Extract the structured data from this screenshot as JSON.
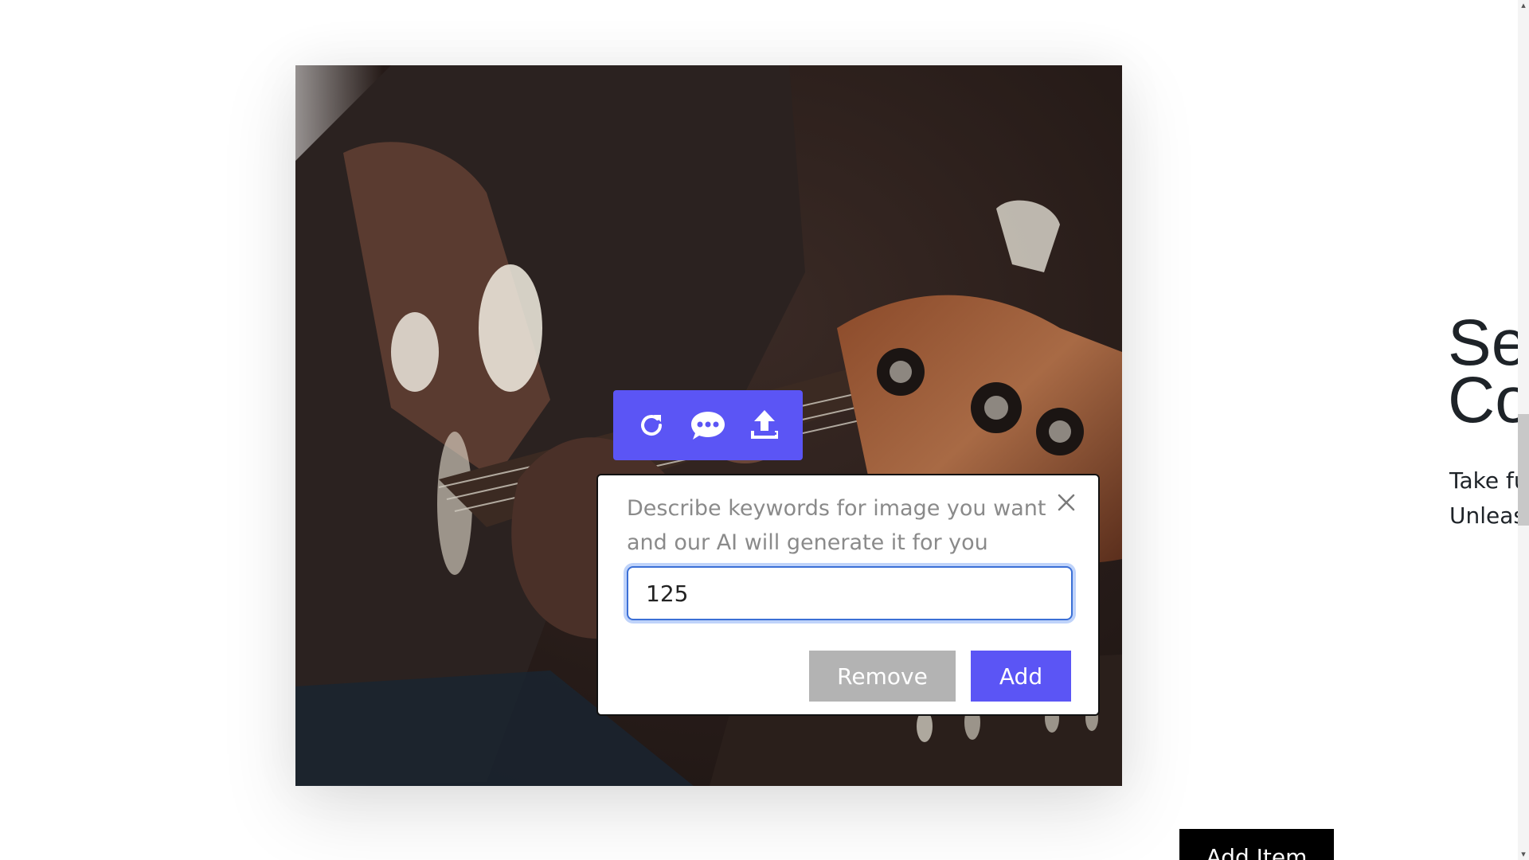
{
  "toolbar": {
    "regenerate_icon": "refresh-icon",
    "comment_icon": "speech-bubble-icon",
    "upload_icon": "upload-icon"
  },
  "dialog": {
    "prompt": "Describe keywords for image you want and our AI will generate it for you",
    "input_value": "125",
    "remove_label": "Remove",
    "add_label": "Add",
    "close_icon": "close-icon"
  },
  "right_panel": {
    "heading_line1": "Se",
    "heading_line2": "Co",
    "text_line1": "Take fu",
    "text_line2": "Unleas"
  },
  "add_item_label": "Add Item",
  "colors": {
    "accent": "#5b55f5",
    "remove_button": "#b3b3b3",
    "add_item_button": "#000000"
  }
}
